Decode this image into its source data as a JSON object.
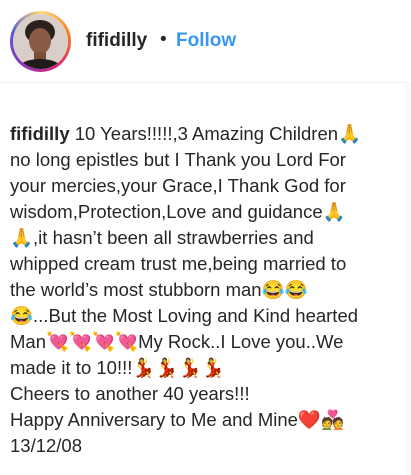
{
  "header": {
    "username": "fifidilly",
    "separator": "•",
    "follow_label": "Follow"
  },
  "caption": {
    "author": "fifidilly",
    "lines": [
      " 10 Years!!!!!,3 Amazing Children🙏",
      "no long epistles but I Thank you Lord For",
      "your mercies,your Grace,I Thank God for",
      "wisdom,Protection,Love and guidance🙏",
      "🙏,it hasn’t been all strawberries and",
      "whipped cream trust me,being married to",
      "the world’s most stubborn man😂😂",
      "😂...But the Most Loving and Kind hearted",
      "Man💘💘💘💘My Rock..I Love you..We",
      "made it to 10!!!💃💃💃💃",
      "Cheers to another 40 years!!!",
      "Happy Anniversary to Me and Mine❤️💑",
      "13/12/08"
    ]
  },
  "colors": {
    "text": "#262626",
    "follow": "#3897f0",
    "divider": "#efefef"
  }
}
